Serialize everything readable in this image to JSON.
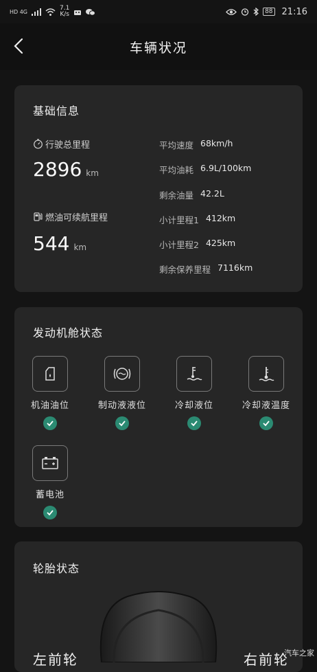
{
  "status_bar": {
    "network_badges": "HD 4G",
    "speed_value": "7.1",
    "speed_unit": "K/s",
    "battery": "88",
    "time": "21:16"
  },
  "header": {
    "title": "车辆状况"
  },
  "basic_info": {
    "title": "基础信息",
    "total_mileage": {
      "label": "行驶总里程",
      "value": "2896",
      "unit": "km"
    },
    "range": {
      "label": "燃油可续航里程",
      "value": "544",
      "unit": "km"
    },
    "stats": [
      {
        "label": "平均速度",
        "value": "68km/h"
      },
      {
        "label": "平均油耗",
        "value": "6.9L/100km"
      },
      {
        "label": "剩余油量",
        "value": "42.2L"
      },
      {
        "label": "小计里程1",
        "value": "412km"
      },
      {
        "label": "小计里程2",
        "value": "425km"
      },
      {
        "label": "剩余保养里程",
        "value": "7116km"
      }
    ]
  },
  "engine": {
    "title": "发动机舱状态",
    "items": [
      {
        "label": "机油油位",
        "icon": "oil-can-icon",
        "status": "ok"
      },
      {
        "label": "制动液液位",
        "icon": "brake-fluid-icon",
        "status": "ok"
      },
      {
        "label": "冷却液位",
        "icon": "coolant-level-icon",
        "status": "ok"
      },
      {
        "label": "冷却液温度",
        "icon": "coolant-temp-icon",
        "status": "ok"
      },
      {
        "label": "蓄电池",
        "icon": "battery-icon",
        "status": "ok"
      }
    ]
  },
  "tires": {
    "title": "轮胎状态",
    "front_left": "左前轮",
    "front_right": "右前轮"
  },
  "watermark": "汽车之家",
  "colors": {
    "accent_ok": "#2b8a72",
    "card": "#262626",
    "background": "#141414"
  }
}
